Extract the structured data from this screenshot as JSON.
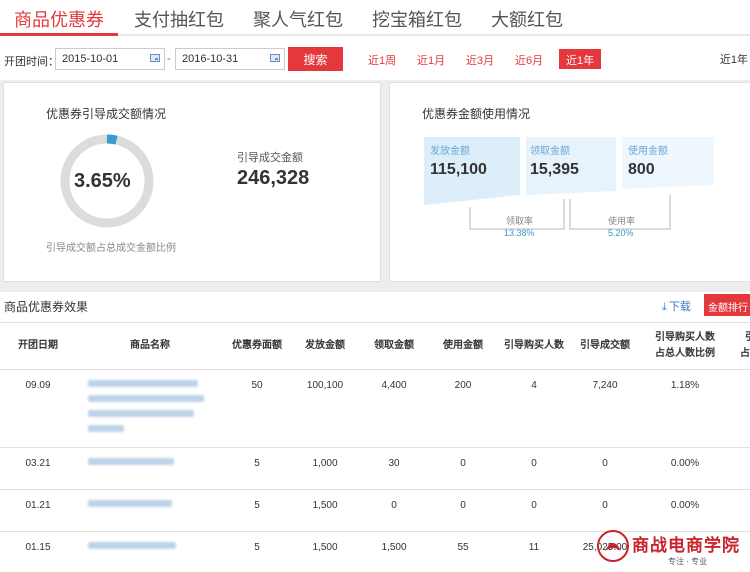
{
  "tabs": [
    {
      "label": "商品优惠券",
      "active": true
    },
    {
      "label": "支付抽红包",
      "active": false
    },
    {
      "label": "聚人气红包",
      "active": false
    },
    {
      "label": "挖宝箱红包",
      "active": false
    },
    {
      "label": "大额红包",
      "active": false
    }
  ],
  "filter": {
    "label": "开团时间：",
    "start_date": "2015-10-01",
    "end_date": "2016-10-31",
    "separator": "-",
    "search_label": "搜索",
    "quick_ranges": [
      "近1周",
      "近1月",
      "近3月",
      "近6月",
      "近1年"
    ],
    "active_range": "近1年",
    "right_text": "近1年"
  },
  "guide_panel": {
    "title": "优惠券引导成交额情况",
    "ratio_value": "3.65%",
    "ratio_fraction": 0.0365,
    "ratio_note": "引导成交额占总成交金额比例",
    "amount_label": "引导成交金额",
    "amount_value": "246,328"
  },
  "usage_panel": {
    "title": "优惠券金额使用情况",
    "cards": [
      {
        "label": "发放金额",
        "value": "115,100"
      },
      {
        "label": "领取金额",
        "value": "15,395"
      },
      {
        "label": "使用金额",
        "value": "800"
      }
    ],
    "rates": [
      {
        "label": "领取率",
        "value": "13.38%"
      },
      {
        "label": "使用率",
        "value": "5.20%"
      }
    ]
  },
  "effect_section": {
    "title": "商品优惠券效果",
    "download_label": "下载",
    "sort_label": "金额排行"
  },
  "table": {
    "headers": [
      "开团日期",
      "商品名称",
      "优惠券面额",
      "发放金额",
      "领取金额",
      "使用金额",
      "引导购买人数",
      "引导成交额",
      "引导购买人数占总人数比例",
      "引导成交额占总成交额比例"
    ],
    "header_lines": [
      [
        "开团日期"
      ],
      [
        "商品名称"
      ],
      [
        "优惠券面额"
      ],
      [
        "发放金额"
      ],
      [
        "领取金额"
      ],
      [
        "使用金额"
      ],
      [
        "引导购买人数"
      ],
      [
        "引导成交额"
      ],
      [
        "引导购买人数",
        "占总人数比例"
      ],
      [
        "引",
        "占总"
      ]
    ],
    "rows": [
      {
        "date": "09.09",
        "face": "50",
        "issued": "100,100",
        "received": "4,400",
        "used": "200",
        "buyers": "4",
        "deal": "7,240",
        "buyer_ratio": "1.18%",
        "name_lines": [
          110,
          116,
          106,
          36
        ]
      },
      {
        "date": "03.21",
        "face": "5",
        "issued": "1,000",
        "received": "30",
        "used": "0",
        "buyers": "0",
        "deal": "0",
        "buyer_ratio": "0.00%",
        "name_lines": [
          86
        ]
      },
      {
        "date": "01.21",
        "face": "5",
        "issued": "1,500",
        "received": "0",
        "used": "0",
        "buyers": "0",
        "deal": "0",
        "buyer_ratio": "0.00%",
        "name_lines": [
          84
        ]
      },
      {
        "date": "01.15",
        "face": "5",
        "issued": "1,500",
        "received": "1,500",
        "used": "55",
        "buyers": "11",
        "deal": "25,025.00",
        "buyer_ratio": "",
        "name_lines": [
          88
        ]
      }
    ]
  },
  "watermark": {
    "text": "商战电商学院",
    "sub": "专注 · 专业"
  },
  "colors": {
    "accent": "#e4393c",
    "ring": "#3a9bd0",
    "ring_track": "#dcdcdc",
    "card_bg": "#dbeefa",
    "card_bg_light": "#eef7fd"
  }
}
